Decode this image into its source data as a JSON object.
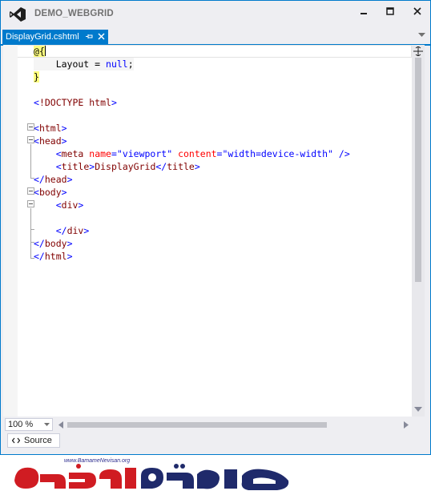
{
  "window": {
    "title": "DEMO_WEBGRID",
    "icons": {
      "logo": "visual-studio-logo",
      "minimize": "minimize-icon",
      "maximize": "maximize-icon",
      "close": "close-icon"
    }
  },
  "tabs": [
    {
      "label": "DisplayGrid.cshtml",
      "active": true
    }
  ],
  "editor": {
    "lines": [
      "@{",
      "    Layout = null;",
      "}",
      "",
      "<!DOCTYPE html>",
      "",
      "<html>",
      "<head>",
      "    <meta name=\"viewport\" content=\"width=device-width\" />",
      "    <title>DisplayGrid</title>",
      "</head>",
      "<body>",
      "    <div>",
      "",
      "    </div>",
      "</body>",
      "</html>"
    ]
  },
  "status": {
    "zoom": "100 %",
    "view_button": "Source"
  },
  "watermark": {
    "url": "www.BamameNevisan.org",
    "brand": "برنامه نویسان"
  },
  "colors": {
    "accent": "#007acc",
    "chrome": "#eeeef2",
    "tag": "#800000",
    "attr": "#ff0000",
    "value": "#0000ff",
    "razor_highlight": "#ffff80"
  }
}
